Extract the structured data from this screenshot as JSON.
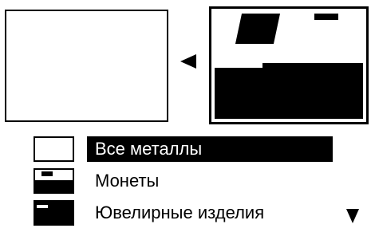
{
  "menu": {
    "items": [
      {
        "label": "Все металлы",
        "selected": true
      },
      {
        "label": "Монеты",
        "selected": false
      },
      {
        "label": "Ювелирные изделия",
        "selected": false
      }
    ]
  },
  "icons": {
    "arrow": "left-triangle-icon",
    "scroll": "scroll-down-triangle-icon"
  }
}
